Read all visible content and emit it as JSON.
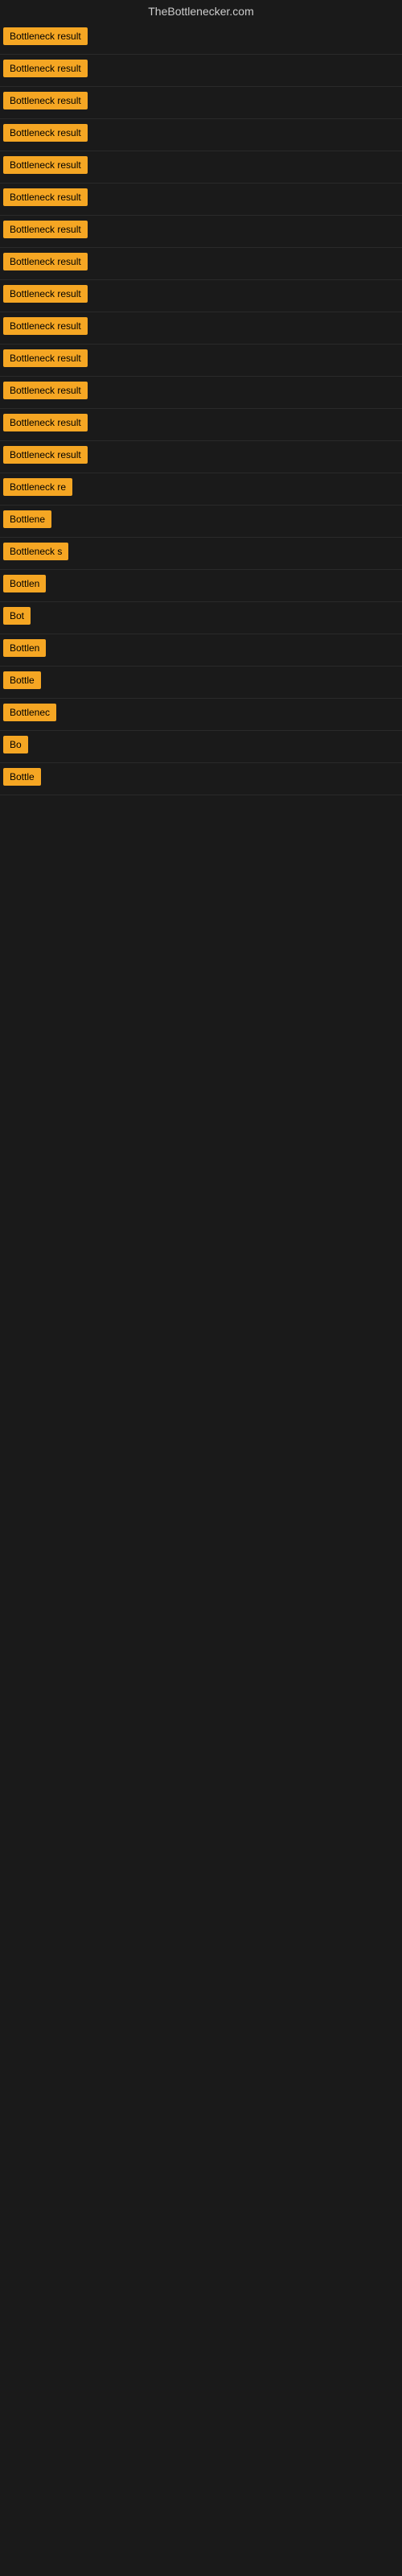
{
  "site": {
    "title": "TheBottlenecker.com"
  },
  "results": [
    {
      "id": 1,
      "label": "Bottleneck result",
      "visible_chars": 16
    },
    {
      "id": 2,
      "label": "Bottleneck result",
      "visible_chars": 16
    },
    {
      "id": 3,
      "label": "Bottleneck result",
      "visible_chars": 16
    },
    {
      "id": 4,
      "label": "Bottleneck result",
      "visible_chars": 16
    },
    {
      "id": 5,
      "label": "Bottleneck result",
      "visible_chars": 16
    },
    {
      "id": 6,
      "label": "Bottleneck result",
      "visible_chars": 16
    },
    {
      "id": 7,
      "label": "Bottleneck result",
      "visible_chars": 16
    },
    {
      "id": 8,
      "label": "Bottleneck result",
      "visible_chars": 16
    },
    {
      "id": 9,
      "label": "Bottleneck result",
      "visible_chars": 16
    },
    {
      "id": 10,
      "label": "Bottleneck result",
      "visible_chars": 16
    },
    {
      "id": 11,
      "label": "Bottleneck result",
      "visible_chars": 16
    },
    {
      "id": 12,
      "label": "Bottleneck result",
      "visible_chars": 16
    },
    {
      "id": 13,
      "label": "Bottleneck result",
      "visible_chars": 16
    },
    {
      "id": 14,
      "label": "Bottleneck result",
      "visible_chars": 16
    },
    {
      "id": 15,
      "label": "Bottleneck re",
      "visible_chars": 13
    },
    {
      "id": 16,
      "label": "Bottlene",
      "visible_chars": 8
    },
    {
      "id": 17,
      "label": "Bottleneck s",
      "visible_chars": 12
    },
    {
      "id": 18,
      "label": "Bottlen",
      "visible_chars": 7
    },
    {
      "id": 19,
      "label": "Bot",
      "visible_chars": 3
    },
    {
      "id": 20,
      "label": "Bottlen",
      "visible_chars": 7
    },
    {
      "id": 21,
      "label": "Bottle",
      "visible_chars": 6
    },
    {
      "id": 22,
      "label": "Bottlenec",
      "visible_chars": 9
    },
    {
      "id": 23,
      "label": "Bo",
      "visible_chars": 2
    },
    {
      "id": 24,
      "label": "Bottle",
      "visible_chars": 6
    }
  ],
  "colors": {
    "badge_bg": "#f5a623",
    "badge_text": "#000000",
    "page_bg": "#1a1a1a",
    "title_text": "#cccccc"
  }
}
